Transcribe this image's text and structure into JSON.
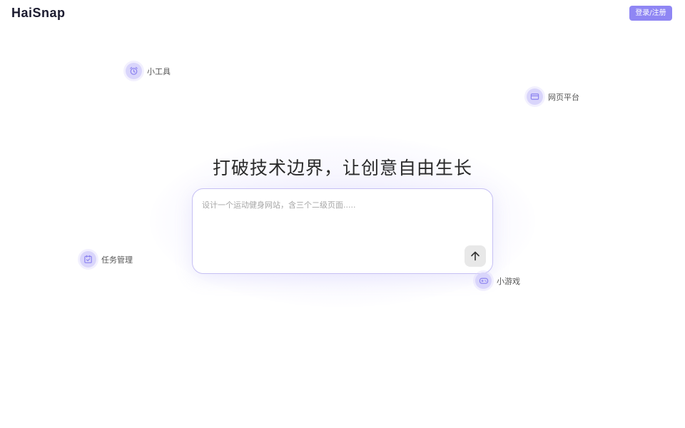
{
  "header": {
    "logo": "HaiSnap",
    "login_label": "登录/注册"
  },
  "hero": {
    "headline": "打破技术边界，让创意自由生长",
    "prompt_placeholder": "设计一个运动健身网站，含三个二级页面.....",
    "send_icon": "arrow-up-icon"
  },
  "categories": [
    {
      "label": "小工具",
      "icon": "alarm-clock-icon"
    },
    {
      "label": "网页平台",
      "icon": "card-icon"
    },
    {
      "label": "任务管理",
      "icon": "calendar-check-icon"
    },
    {
      "label": "小游戏",
      "icon": "gamepad-icon"
    }
  ],
  "colors": {
    "accent": "#8f86f4",
    "chip_bg": "#d9d5fb",
    "box_border": "#c6c0f4",
    "icon": "#8d84f0"
  }
}
